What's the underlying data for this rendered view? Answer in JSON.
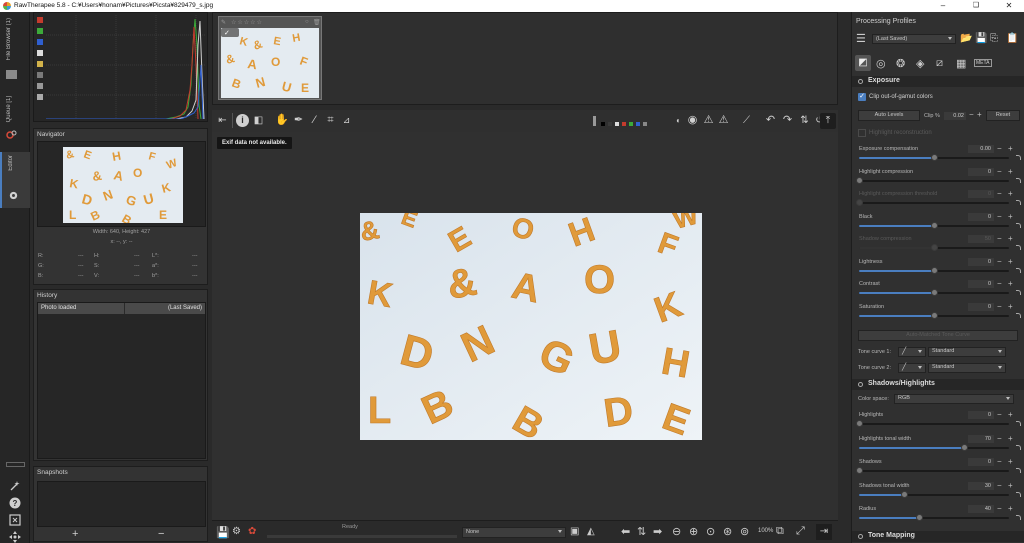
{
  "window": {
    "title": "RawTherapee 5.8 - C:¥Users¥honam¥Pictures¥Picsta¥829479_s.jpg",
    "minimize": "–",
    "maximize": "❑",
    "close": "✕"
  },
  "tabs": {
    "file_browser": "File Browser (1)",
    "queue": "Queue [1]",
    "editor": "Editor"
  },
  "navigator": {
    "title": "Navigator",
    "size_text": "Width: 640, Height: 427",
    "coords": "x: --, y: --",
    "readouts": [
      {
        "k": "R:",
        "v": "---"
      },
      {
        "k": "H:",
        "v": "---"
      },
      {
        "k": "L*:",
        "v": "---"
      },
      {
        "k": "G:",
        "v": "---"
      },
      {
        "k": "S:",
        "v": "---"
      },
      {
        "k": "a*:",
        "v": "---"
      },
      {
        "k": "B:",
        "v": "---"
      },
      {
        "k": "V:",
        "v": "---"
      },
      {
        "k": "b*:",
        "v": "---"
      }
    ]
  },
  "history": {
    "title": "History",
    "rows": [
      {
        "name": "Photo loaded",
        "value": "(Last Saved)"
      }
    ]
  },
  "snapshots": {
    "title": "Snapshots",
    "add": "+",
    "remove": "−"
  },
  "editor": {
    "tooltip": "Exif data not available.",
    "status": "Ready",
    "preview_profile": "None",
    "zoom": "100%",
    "zoom_ratio": "1:1"
  },
  "right": {
    "profiles_title": "Processing Profiles",
    "profile_value": "(Last Saved)",
    "exposure": {
      "title": "Exposure",
      "clip_label": "Clip out-of-gamut colors",
      "auto_levels": "Auto Levels",
      "clip_pct_label": "Clip %",
      "clip_pct_value": "0.02",
      "reset": "Reset",
      "highlight_recon": "Highlight reconstruction",
      "sliders": [
        {
          "label": "Exposure compensation",
          "value": "0.00",
          "pos": 0.5
        },
        {
          "label": "Highlight compression",
          "value": "0",
          "pos": 0.0
        },
        {
          "label": "Highlight compression threshold",
          "value": "0",
          "pos": 0.0,
          "dim": true
        },
        {
          "label": "Black",
          "value": "0",
          "pos": 0.5
        },
        {
          "label": "Shadow compression",
          "value": "50",
          "pos": 0.5,
          "dim": true
        },
        {
          "label": "Lightness",
          "value": "0",
          "pos": 0.5
        },
        {
          "label": "Contrast",
          "value": "0",
          "pos": 0.5
        },
        {
          "label": "Saturation",
          "value": "0",
          "pos": 0.5
        }
      ],
      "auto_matched": "Auto-Matched Tone Curve",
      "tone_curve_1_label": "Tone curve 1:",
      "tone_curve_1_value": "Standard",
      "tone_curve_2_label": "Tone curve 2:",
      "tone_curve_2_value": "Standard"
    },
    "shadows_highlights": {
      "title": "Shadows/Highlights",
      "color_space_label": "Color space:",
      "color_space_value": "RGB",
      "sliders": [
        {
          "label": "Highlights",
          "value": "0",
          "pos": 0.0
        },
        {
          "label": "Highlights tonal width",
          "value": "70",
          "pos": 0.7
        },
        {
          "label": "Shadows",
          "value": "0",
          "pos": 0.0
        },
        {
          "label": "Shadows tonal width",
          "value": "30",
          "pos": 0.3
        },
        {
          "label": "Radius",
          "value": "40",
          "pos": 0.4
        }
      ]
    },
    "tone_mapping": {
      "title": "Tone Mapping"
    }
  },
  "colors": {
    "accent": "#4a7ec0",
    "letters": "#e09a3a",
    "photo_bg": "#e4ebf1"
  }
}
